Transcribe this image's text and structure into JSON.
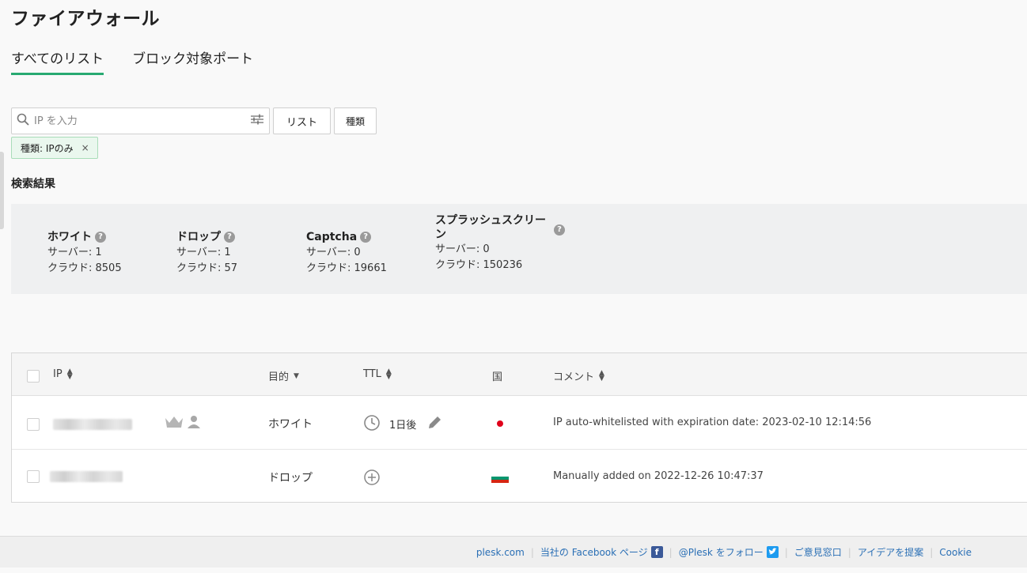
{
  "page": {
    "title": "ファイアウォール"
  },
  "tabs": [
    {
      "label": "すべてのリスト",
      "active": true
    },
    {
      "label": "ブロック対象ポート",
      "active": false
    }
  ],
  "search": {
    "placeholder": "IP を入力",
    "value": "",
    "list_button": "リスト",
    "type_button": "種類"
  },
  "filter_chip": {
    "label": "種類: IPのみ",
    "remove": "×"
  },
  "results_label": "検索結果",
  "stats": [
    {
      "title": "ホワイト",
      "server": "サーバー: 1",
      "cloud": "クラウド: 8505"
    },
    {
      "title": "ドロップ",
      "server": "サーバー: 1",
      "cloud": "クラウド: 57"
    },
    {
      "title": "Captcha",
      "server": "サーバー: 0",
      "cloud": "クラウド: 19661"
    },
    {
      "title": "スプラッシュスクリーン",
      "server": "サーバー: 0",
      "cloud": "クラウド: 150236"
    }
  ],
  "table": {
    "headers": {
      "ip": "IP",
      "purpose": "目的",
      "ttl": "TTL",
      "country": "国",
      "comment": "コメント"
    },
    "rows": [
      {
        "ip": "",
        "purpose": "ホワイト",
        "ttl": "1日後",
        "comment": "IP auto-whitelisted with expiration date: 2023-02-10 12:14:56"
      },
      {
        "ip": "",
        "purpose": "ドロップ",
        "ttl": "",
        "comment": "Manually added on 2022-12-26 10:47:37"
      }
    ]
  },
  "colors": {
    "accent": "#28aa72",
    "link": "#2a6fb5",
    "country_dot": "#e0001a",
    "flag_white": "#ffffff",
    "flag_green": "#00966e",
    "flag_red": "#d62612"
  },
  "footer": {
    "links": [
      {
        "label": "plesk.com"
      },
      {
        "label": "当社の Facebook ページ"
      },
      {
        "label": "@Plesk をフォロー"
      },
      {
        "label": "ご意見窓口"
      },
      {
        "label": "アイデアを提案"
      },
      {
        "label": "Cookie"
      }
    ]
  }
}
